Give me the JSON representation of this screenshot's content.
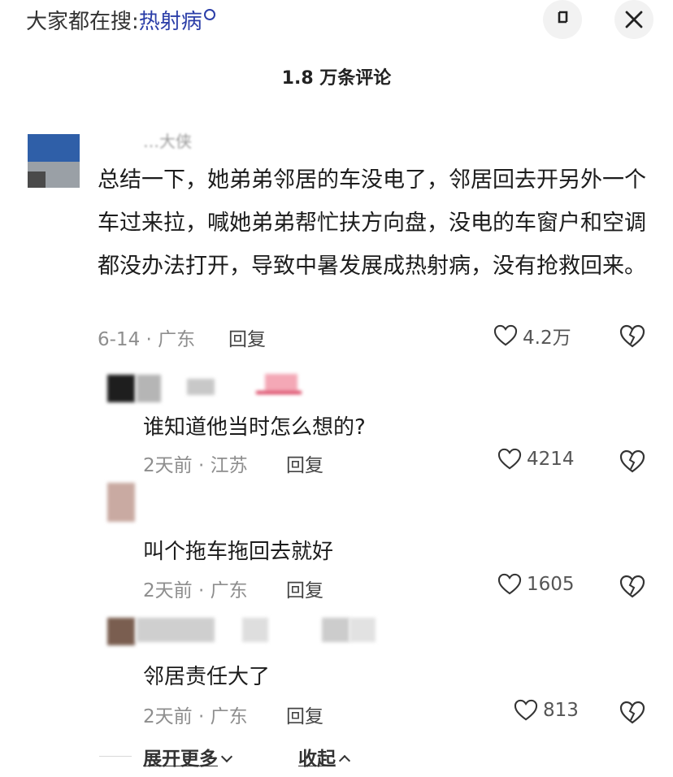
{
  "header": {
    "hot_search_prefix": "大家都在搜:",
    "hot_search_keyword": "热射病",
    "comment_count_title": "1.8 万条评论"
  },
  "main_comment": {
    "author": "…大侠",
    "text": "总结一下，她弟弟邻居的车没电了，邻居回去开另外一个车过来拉，喊她弟弟帮忙扶方向盘，没电的车窗户和空调都没办法打开，导致中暑发展成热射病，没有抢救回来。",
    "meta": "6-14 · 广东",
    "reply_label": "回复",
    "likes": "4.2万"
  },
  "replies": [
    {
      "text": "谁知道他当时怎么想的?",
      "meta": "2天前 · 江苏",
      "reply_label": "回复",
      "likes": "4214"
    },
    {
      "text": "叫个拖车拖回去就好",
      "meta": "2天前 · 广东",
      "reply_label": "回复",
      "likes": "1605"
    },
    {
      "text": "邻居责任大了",
      "meta": "2天前 · 广东",
      "reply_label": "回复",
      "likes": "813"
    }
  ],
  "footer": {
    "expand_label": "展开更多",
    "collapse_label": "收起"
  },
  "colors": {
    "keyword": "#2b3ea8",
    "meta": "#8e8e8e",
    "avatar_blue": "#2f5fa8"
  },
  "icons": [
    "search-icon",
    "collapse-icon",
    "close-icon",
    "heart-icon",
    "dislike-icon",
    "chevron-down-icon",
    "chevron-up-icon"
  ]
}
